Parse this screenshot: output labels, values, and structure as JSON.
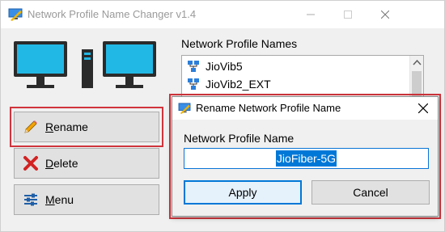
{
  "window": {
    "title": "Network Profile Name Changer v1.4"
  },
  "sidebar": {
    "buttons": [
      {
        "label": "Rename",
        "icon": "pencil-icon"
      },
      {
        "label": "Delete",
        "icon": "red-x-icon"
      },
      {
        "label": "Menu",
        "icon": "sliders-icon"
      }
    ]
  },
  "profiles": {
    "label": "Network Profile Names",
    "items": [
      "JioVib5",
      "JioVib2_EXT"
    ]
  },
  "dialog": {
    "title": "Rename Network Profile Name",
    "field_label": "Network Profile Name",
    "field_value": "JioFiber-5G",
    "apply_label": "Apply",
    "cancel_label": "Cancel"
  },
  "colors": {
    "highlight": "#d0343c",
    "accent": "#0078d7",
    "window_bg": "#f0f0f0"
  }
}
